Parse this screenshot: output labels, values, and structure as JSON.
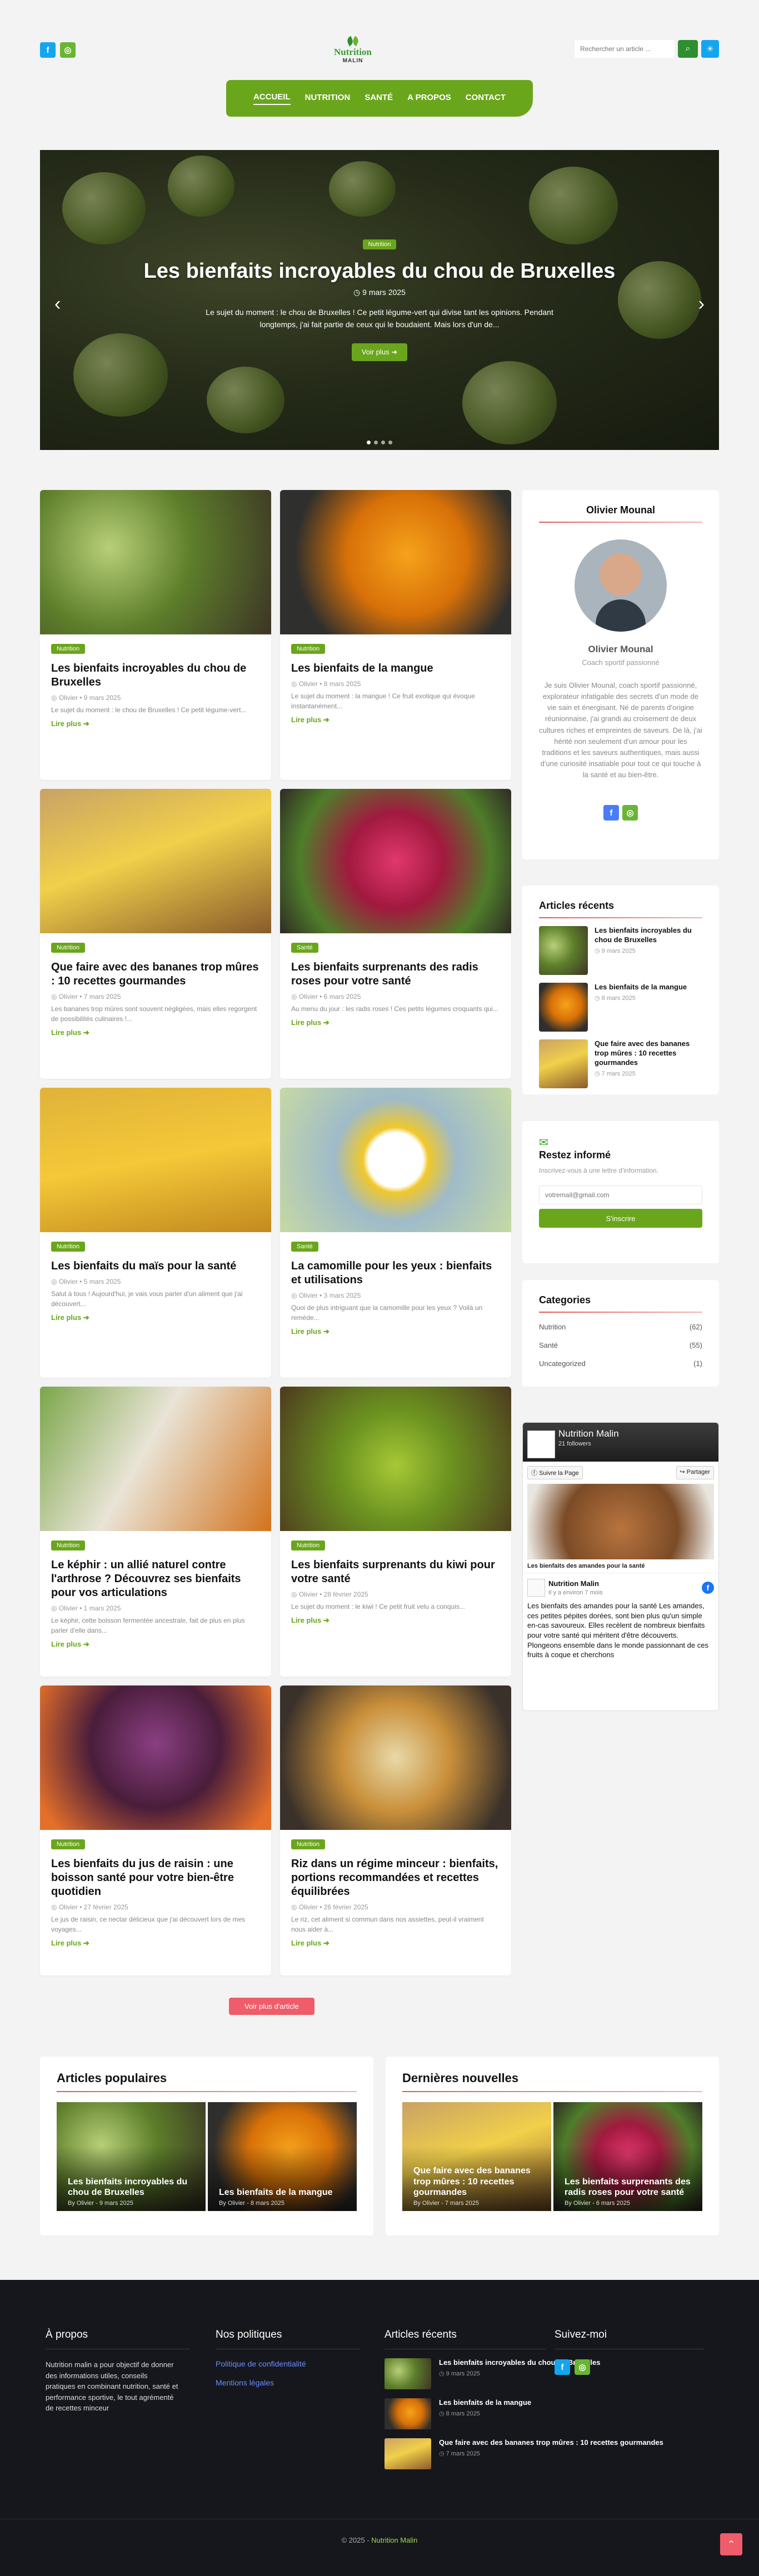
{
  "header": {
    "logo_name": "Nutrition",
    "logo_sub": "MALIN",
    "search_placeholder": "Rechercher un article ...",
    "social": [
      "facebook-icon",
      "instagram-icon"
    ]
  },
  "nav": [
    "ACCUEIL",
    "NUTRITION",
    "SANTÉ",
    "A PROPOS",
    "CONTACT"
  ],
  "hero": {
    "badge": "Nutrition",
    "title": "Les bienfaits incroyables du chou de Bruxelles",
    "date": "9 mars 2025",
    "excerpt": "Le sujet du moment : le chou de Bruxelles ! Ce petit légume-vert qui divise tant les opinions. Pendant longtemps, j'ai fait partie de ceux qui le boudaient. Mais lors d'un de...",
    "readmore": "Voir plus"
  },
  "articles": [
    {
      "badge": "Nutrition",
      "title": "Les bienfaits incroyables du chou de Bruxelles",
      "meta": "Olivier  •  9 mars 2025",
      "excerpt": "Le sujet du moment : le chou de Bruxelles ! Ce petit légume-vert...",
      "more": "Lire plus"
    },
    {
      "badge": "Nutrition",
      "title": "Les bienfaits de la mangue",
      "meta": "Olivier  •  8 mars 2025",
      "excerpt": "Le sujet du moment : la mangue ! Ce fruit exotique qui évoque instantanément...",
      "more": "Lire plus"
    },
    {
      "badge": "Nutrition",
      "title": "Que faire avec des bananes trop mûres : 10 recettes gourmandes",
      "meta": "Olivier  •  7 mars 2025",
      "excerpt": "Les bananes trop mûres sont souvent négligées, mais elles regorgent de possibilités culinaires !...",
      "more": "Lire plus"
    },
    {
      "badge": "Santé",
      "title": "Les bienfaits surprenants des radis roses pour votre santé",
      "meta": "Olivier  •  6 mars 2025",
      "excerpt": "Au menu du jour : les radis roses ! Ces petits légumes croquants qui...",
      "more": "Lire plus"
    },
    {
      "badge": "Nutrition",
      "title": "Les bienfaits du maïs pour la santé",
      "meta": "Olivier  •  5 mars 2025",
      "excerpt": "Salut à tous ! Aujourd'hui, je vais vous parler d'un aliment que j'ai découvert...",
      "more": "Lire plus"
    },
    {
      "badge": "Santé",
      "title": "La camomille pour les yeux : bienfaits et utilisations",
      "meta": "Olivier  •  3 mars 2025",
      "excerpt": "Quoi de plus intriguant que la camomille pour les yeux ? Voilà un remède...",
      "more": "Lire plus"
    },
    {
      "badge": "Nutrition",
      "title": "Le képhir : un allié naturel contre l'arthrose ? Découvrez ses bienfaits pour vos articulations",
      "meta": "Olivier  •  1 mars 2025",
      "excerpt": "Le képhir, cette boisson fermentée ancestrale, fait de plus en plus parler d'elle dans...",
      "more": "Lire plus"
    },
    {
      "badge": "Nutrition",
      "title": "Les bienfaits surprenants du kiwi pour votre santé",
      "meta": "Olivier  •  28 février 2025",
      "excerpt": "Le sujet du moment : le kiwi ! Ce petit fruit velu a conquis...",
      "more": "Lire plus"
    },
    {
      "badge": "Nutrition",
      "title": "Les bienfaits du jus de raisin : une boisson santé pour votre bien-être quotidien",
      "meta": "Olivier  •  27 février 2025",
      "excerpt": "Le jus de raisin, ce nectar délicieux que j'ai découvert lors de mes voyages...",
      "more": "Lire plus"
    },
    {
      "badge": "Nutrition",
      "title": "Riz dans un régime minceur : bienfaits, portions recommandées et recettes équilibrées",
      "meta": "Olivier  •  26 février 2025",
      "excerpt": "Le riz, cet aliment si commun dans nos assiettes, peut-il vraiment nous aider à...",
      "more": "Lire plus"
    }
  ],
  "author": {
    "heading": "Olivier Mounal",
    "name": "Olivier Mounal",
    "role": "Coach sportif passionné",
    "bio": "Je suis Olivier Mounal, coach sportif passionné, explorateur infatigable des secrets d'un mode de vie sain et énergisant. Né de parents d'origine réunionnaise, j'ai grandi au croisement de deux cultures riches et empreintes de saveurs. De là, j'ai hérité non seulement d'un amour pour les traditions et les saveurs authentiques, mais aussi d'une curiosité insatiable pour tout ce qui touche à la santé et au bien-être."
  },
  "recent": {
    "heading": "Articles récents",
    "items": [
      {
        "title": "Les bienfaits incroyables du chou de Bruxelles",
        "date": "9 mars 2025"
      },
      {
        "title": "Les bienfaits de la mangue",
        "date": "8 mars 2025"
      },
      {
        "title": "Que faire avec des bananes trop mûres : 10 recettes gourmandes",
        "date": "7 mars 2025"
      }
    ]
  },
  "newsletter": {
    "heading": "Restez informé",
    "text": "Inscrivez-vous à une lettre d'information.",
    "placeholder": "votremail@gmail.com",
    "button": "S'inscrire"
  },
  "categories": {
    "heading": "Categories",
    "items": [
      {
        "name": "Nutrition",
        "count": "(62)"
      },
      {
        "name": "Santé",
        "count": "(55)"
      },
      {
        "name": "Uncategorized",
        "count": "(1)"
      }
    ]
  },
  "facebook": {
    "page_name": "Nutrition Malin",
    "followers": "21 followers",
    "follow": "Suivre la Page",
    "share": "Partager",
    "caption": "Les bienfaits des amandes pour la santé",
    "post_author": "Nutrition Malin",
    "post_time": "Il y a environ 7 mois",
    "post_text": "Les bienfaits des amandes pour la santé Les amandes, ces petites pépites dorées, sont bien plus qu'un simple en-cas savoureux. Elles recèlent de nombreux bienfaits pour votre santé qui méritent d'être découverts. Plongeons ensemble dans le monde passionnant de ces fruits à coque et cherchons"
  },
  "view_more": "Voir plus d'article",
  "popular": {
    "heading": "Articles populaires",
    "tiles": [
      {
        "title": "Les bienfaits incroyables du chou de Bruxelles",
        "meta": "By  Olivier  -  9 mars 2025"
      },
      {
        "title": "Les bienfaits de la mangue",
        "meta": "By  Olivier  -  8 mars 2025"
      }
    ]
  },
  "latest": {
    "heading": "Dernières nouvelles",
    "tiles": [
      {
        "title": "Que faire avec des bananes trop mûres : 10 recettes gourmandes",
        "meta": "By  Olivier  -  7 mars 2025"
      },
      {
        "title": "Les bienfaits surprenants des radis roses pour votre santé",
        "meta": "By  Olivier  -  6 mars 2025"
      }
    ]
  },
  "footer": {
    "about_heading": "À propos",
    "about_text": "Nutrition malin a pour objectif de donner des informations utiles, conseils pratiques en combinant nutrition, santé et performance sportive, le tout agrémenté de recettes minceur",
    "policies_heading": "Nos politiques",
    "policies": [
      "Politique de confidentialité",
      "Mentions légales"
    ],
    "recent_heading": "Articles récents",
    "recent": [
      {
        "title": "Les bienfaits incroyables du chou de Bruxelles",
        "date": "9 mars 2025"
      },
      {
        "title": "Les bienfaits de la mangue",
        "date": "8 mars 2025"
      },
      {
        "title": "Que faire avec des bananes trop mûres : 10 recettes gourmandes",
        "date": "7 mars 2025"
      }
    ],
    "follow_heading": "Suivez-moi",
    "copyright_prefix": "© 2025 - ",
    "copyright_brand": "Nutrition Malin"
  }
}
